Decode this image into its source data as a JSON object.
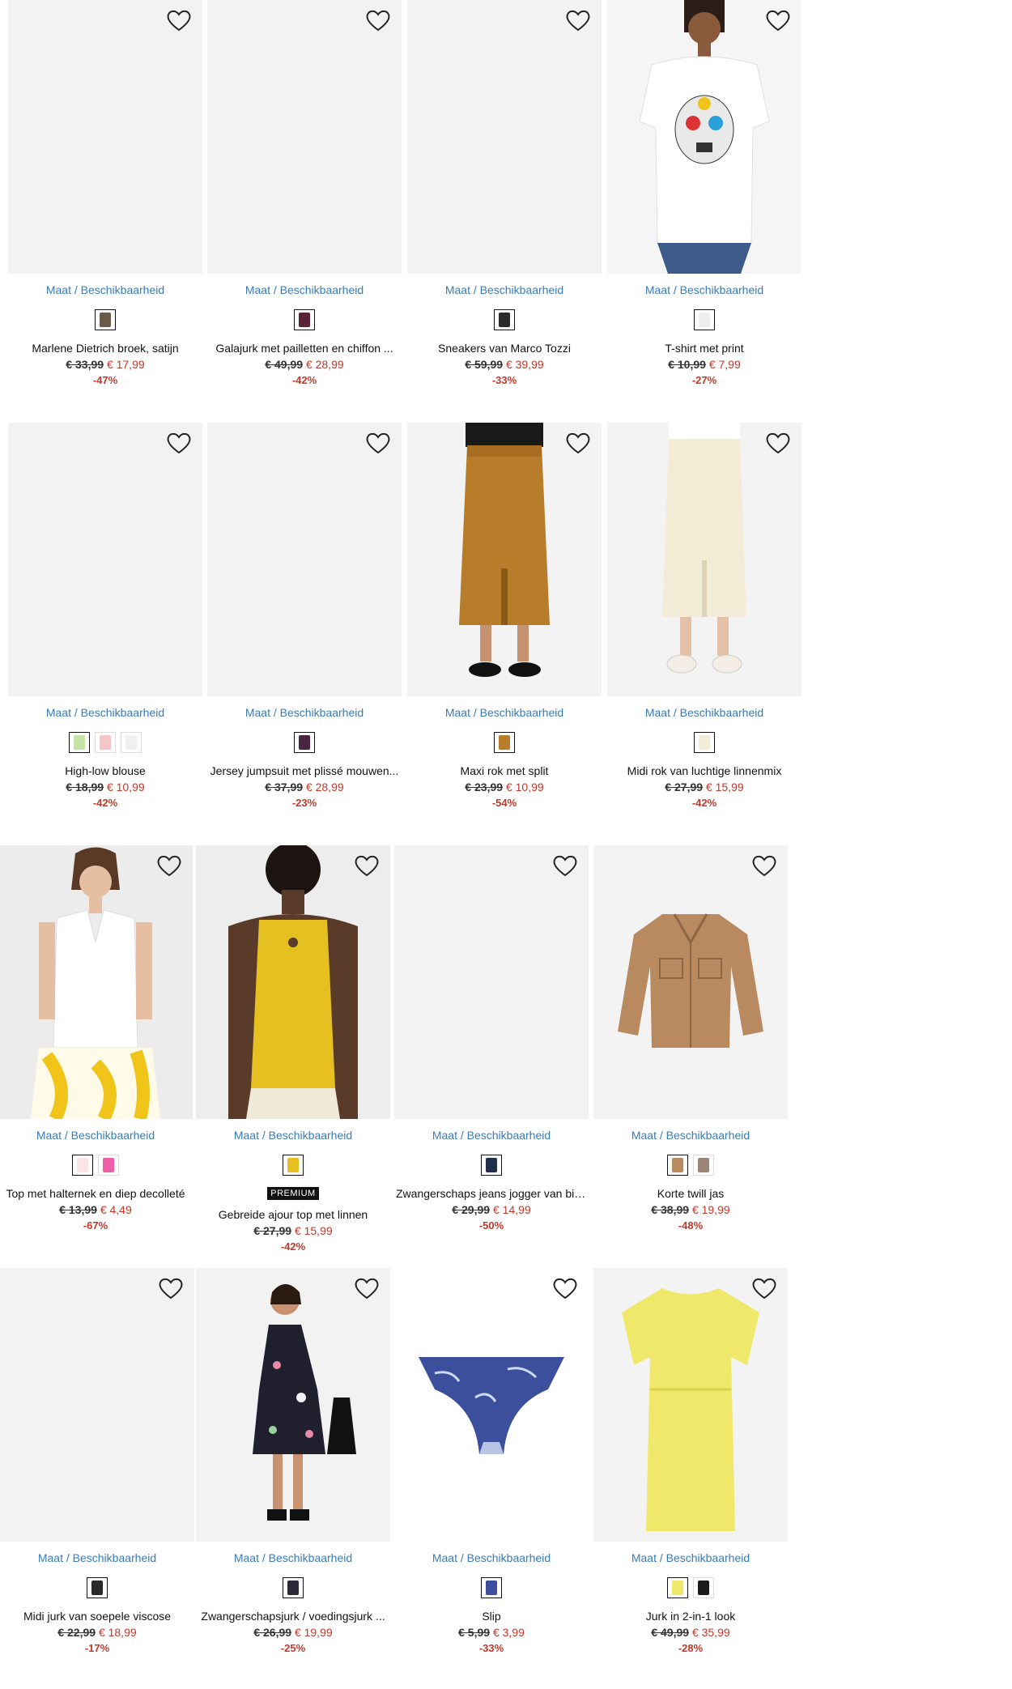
{
  "size_link_label": "Maat / Beschikbaarheid",
  "colors": {
    "link": "#3a7bb5",
    "sale": "#c0392b",
    "image_bg": "#f2f2f2"
  },
  "products": [
    {
      "name": "Marlene Dietrich broek, satijn",
      "old_price": "€ 33,99",
      "new_price": "€ 17,99",
      "discount": "-47%",
      "image": "placeholder",
      "swatches": [
        "#6b5a48"
      ],
      "badge": ""
    },
    {
      "name": "Galajurk met pailletten en chiffon ...",
      "old_price": "€ 49,99",
      "new_price": "€ 28,99",
      "discount": "-42%",
      "image": "placeholder",
      "swatches": [
        "#5a2236"
      ],
      "badge": ""
    },
    {
      "name": "Sneakers van Marco Tozzi",
      "old_price": "€ 59,99",
      "new_price": "€ 39,99",
      "discount": "-33%",
      "image": "placeholder",
      "swatches": [
        "#2a2a2a"
      ],
      "badge": ""
    },
    {
      "name": "T-shirt met print",
      "old_price": "€ 10,99",
      "new_price": "€ 7,99",
      "discount": "-27%",
      "image": "tshirt",
      "swatches": [
        "#eeeeee"
      ],
      "badge": ""
    },
    {
      "name": "High-low blouse",
      "old_price": "€ 18,99",
      "new_price": "€ 10,99",
      "discount": "-42%",
      "image": "placeholder",
      "swatches": [
        "#c6e3a6",
        "#f4c6c8",
        "#f0f0f2"
      ],
      "badge": ""
    },
    {
      "name": "Jersey jumpsuit met plissé mouwen...",
      "old_price": "€ 37,99",
      "new_price": "€ 28,99",
      "discount": "-23%",
      "image": "placeholder",
      "swatches": [
        "#4a2440"
      ],
      "badge": ""
    },
    {
      "name": "Maxi rok met split",
      "old_price": "€ 23,99",
      "new_price": "€ 10,99",
      "discount": "-54%",
      "image": "skirt-brown",
      "swatches": [
        "#b87d2a"
      ],
      "badge": ""
    },
    {
      "name": "Midi rok van luchtige linnenmix",
      "old_price": "€ 27,99",
      "new_price": "€ 15,99",
      "discount": "-42%",
      "image": "skirt-cream",
      "swatches": [
        "#f3edd8"
      ],
      "badge": ""
    },
    {
      "name": "Top met halternek en diep decolleté",
      "old_price": "€ 13,99",
      "new_price": "€ 4,49",
      "discount": "-67%",
      "image": "halter-top",
      "swatches": [
        "#fbe4e8",
        "#ef5fa7"
      ],
      "badge": ""
    },
    {
      "name": "Gebreide ajour top met linnen",
      "old_price": "€ 27,99",
      "new_price": "€ 15,99",
      "discount": "-42%",
      "image": "yellow-top",
      "swatches": [
        "#e6c020"
      ],
      "badge": "PREMIUM"
    },
    {
      "name": "Zwangerschaps jeans jogger van bio...",
      "old_price": "€ 29,99",
      "new_price": "€ 14,99",
      "discount": "-50%",
      "image": "placeholder",
      "swatches": [
        "#1f2e4a"
      ],
      "badge": ""
    },
    {
      "name": "Korte twill jas",
      "old_price": "€ 38,99",
      "new_price": "€ 19,99",
      "discount": "-48%",
      "image": "jacket",
      "swatches": [
        "#b98a5f",
        "#9a8574"
      ],
      "badge": ""
    },
    {
      "name": "Midi jurk van soepele viscose",
      "old_price": "€ 22,99",
      "new_price": "€ 18,99",
      "discount": "-17%",
      "image": "placeholder",
      "swatches": [
        "#2b2a26"
      ],
      "badge": ""
    },
    {
      "name": "Zwangerschapsjurk / voedingsjurk ...",
      "old_price": "€ 26,99",
      "new_price": "€ 19,99",
      "discount": "-25%",
      "image": "maternity-dress",
      "swatches": [
        "#2a2a3a"
      ],
      "badge": ""
    },
    {
      "name": "Slip",
      "old_price": "€ 5,99",
      "new_price": "€ 3,99",
      "discount": "-33%",
      "image": "slip",
      "swatches": [
        "#3b4f9c"
      ],
      "badge": ""
    },
    {
      "name": "Jurk in 2-in-1 look",
      "old_price": "€ 49,99",
      "new_price": "€ 35,99",
      "discount": "-28%",
      "image": "yellow-dress",
      "swatches": [
        "#efe86a",
        "#1a1a1a"
      ],
      "badge": ""
    }
  ]
}
